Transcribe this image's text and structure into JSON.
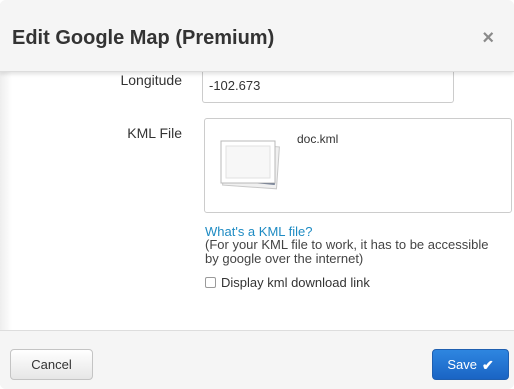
{
  "dialog": {
    "title": "Edit Google Map (Premium)",
    "close_label": "×"
  },
  "form": {
    "longitude_label": "Longitude",
    "longitude_value": "-102.673",
    "kml_label": "KML File",
    "kml_file_name": "doc.kml",
    "kml_help_link": "What's a KML file?",
    "kml_help_note": "(For your KML file to work, it has to be accessible by google over the internet)",
    "display_download_label": "Display kml download link",
    "display_download_checked": false
  },
  "footer": {
    "cancel_label": "Cancel",
    "save_label": "Save",
    "save_icon": "checkmark-icon"
  },
  "colors": {
    "primary_button": "#2a7ad5",
    "link": "#1e8bc3",
    "header_bg": "#f5f5f5"
  }
}
